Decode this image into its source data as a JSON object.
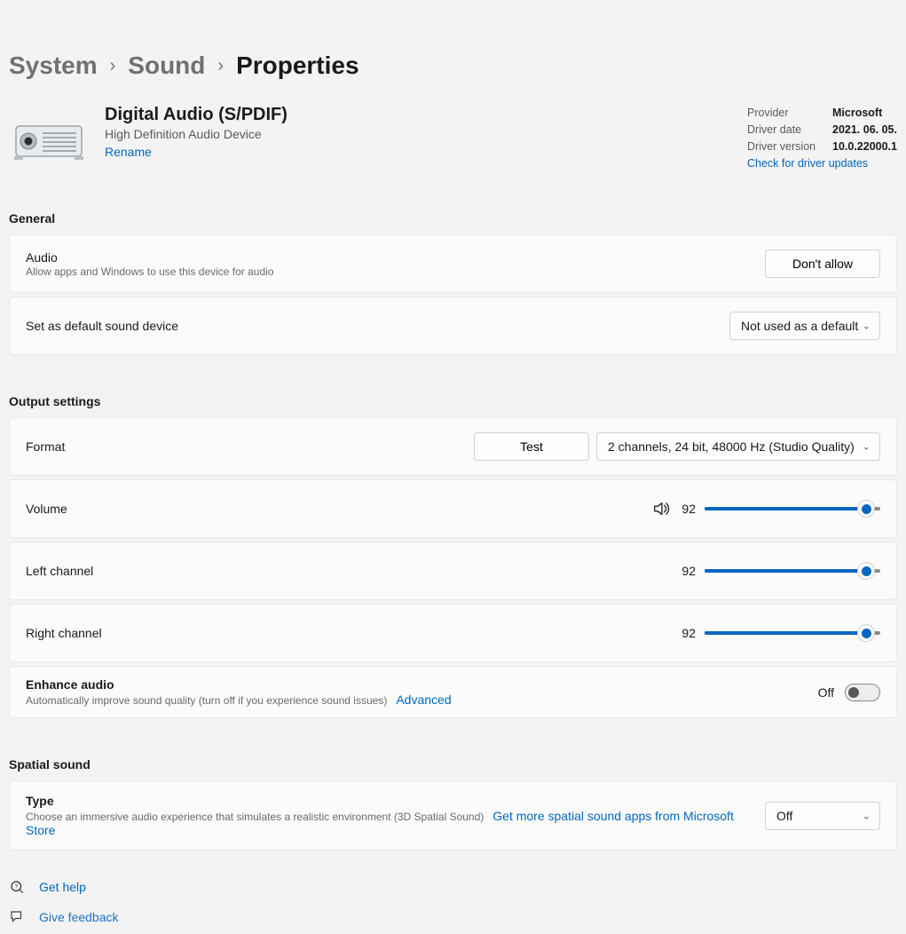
{
  "breadcrumb": {
    "items": [
      {
        "label": "System"
      },
      {
        "label": "Sound"
      },
      {
        "label": "Properties"
      }
    ]
  },
  "device": {
    "title": "Digital Audio (S/PDIF)",
    "subtitle": "High Definition Audio Device",
    "rename": "Rename"
  },
  "driver": {
    "provider_label": "Provider",
    "provider_value": "Microsoft",
    "date_label": "Driver date",
    "date_value": "2021. 06. 05.",
    "version_label": "Driver version",
    "version_value": "10.0.22000.1",
    "check_updates": "Check for driver updates"
  },
  "general": {
    "heading": "General",
    "audio": {
      "title": "Audio",
      "subtitle": "Allow apps and Windows to use this device for audio",
      "button": "Don't allow"
    },
    "default": {
      "title": "Set as default sound device",
      "value": "Not used as a default"
    }
  },
  "output": {
    "heading": "Output settings",
    "format": {
      "title": "Format",
      "test": "Test",
      "value": "2 channels, 24 bit, 48000 Hz (Studio Quality)"
    },
    "volume": {
      "title": "Volume",
      "value": "92",
      "percent": 92
    },
    "left": {
      "title": "Left channel",
      "value": "92",
      "percent": 92
    },
    "right": {
      "title": "Right channel",
      "value": "92",
      "percent": 92
    },
    "enhance": {
      "title": "Enhance audio",
      "subtitle": "Automatically improve sound quality (turn off if you experience sound issues)",
      "advanced": "Advanced",
      "state": "Off"
    }
  },
  "spatial": {
    "heading": "Spatial sound",
    "type": {
      "title": "Type",
      "subtitle": "Choose an immersive audio experience that simulates a realistic environment (3D Spatial Sound)",
      "store_link": "Get more spatial sound apps from Microsoft Store",
      "value": "Off"
    }
  },
  "footer": {
    "help": "Get help",
    "feedback": "Give feedback"
  }
}
